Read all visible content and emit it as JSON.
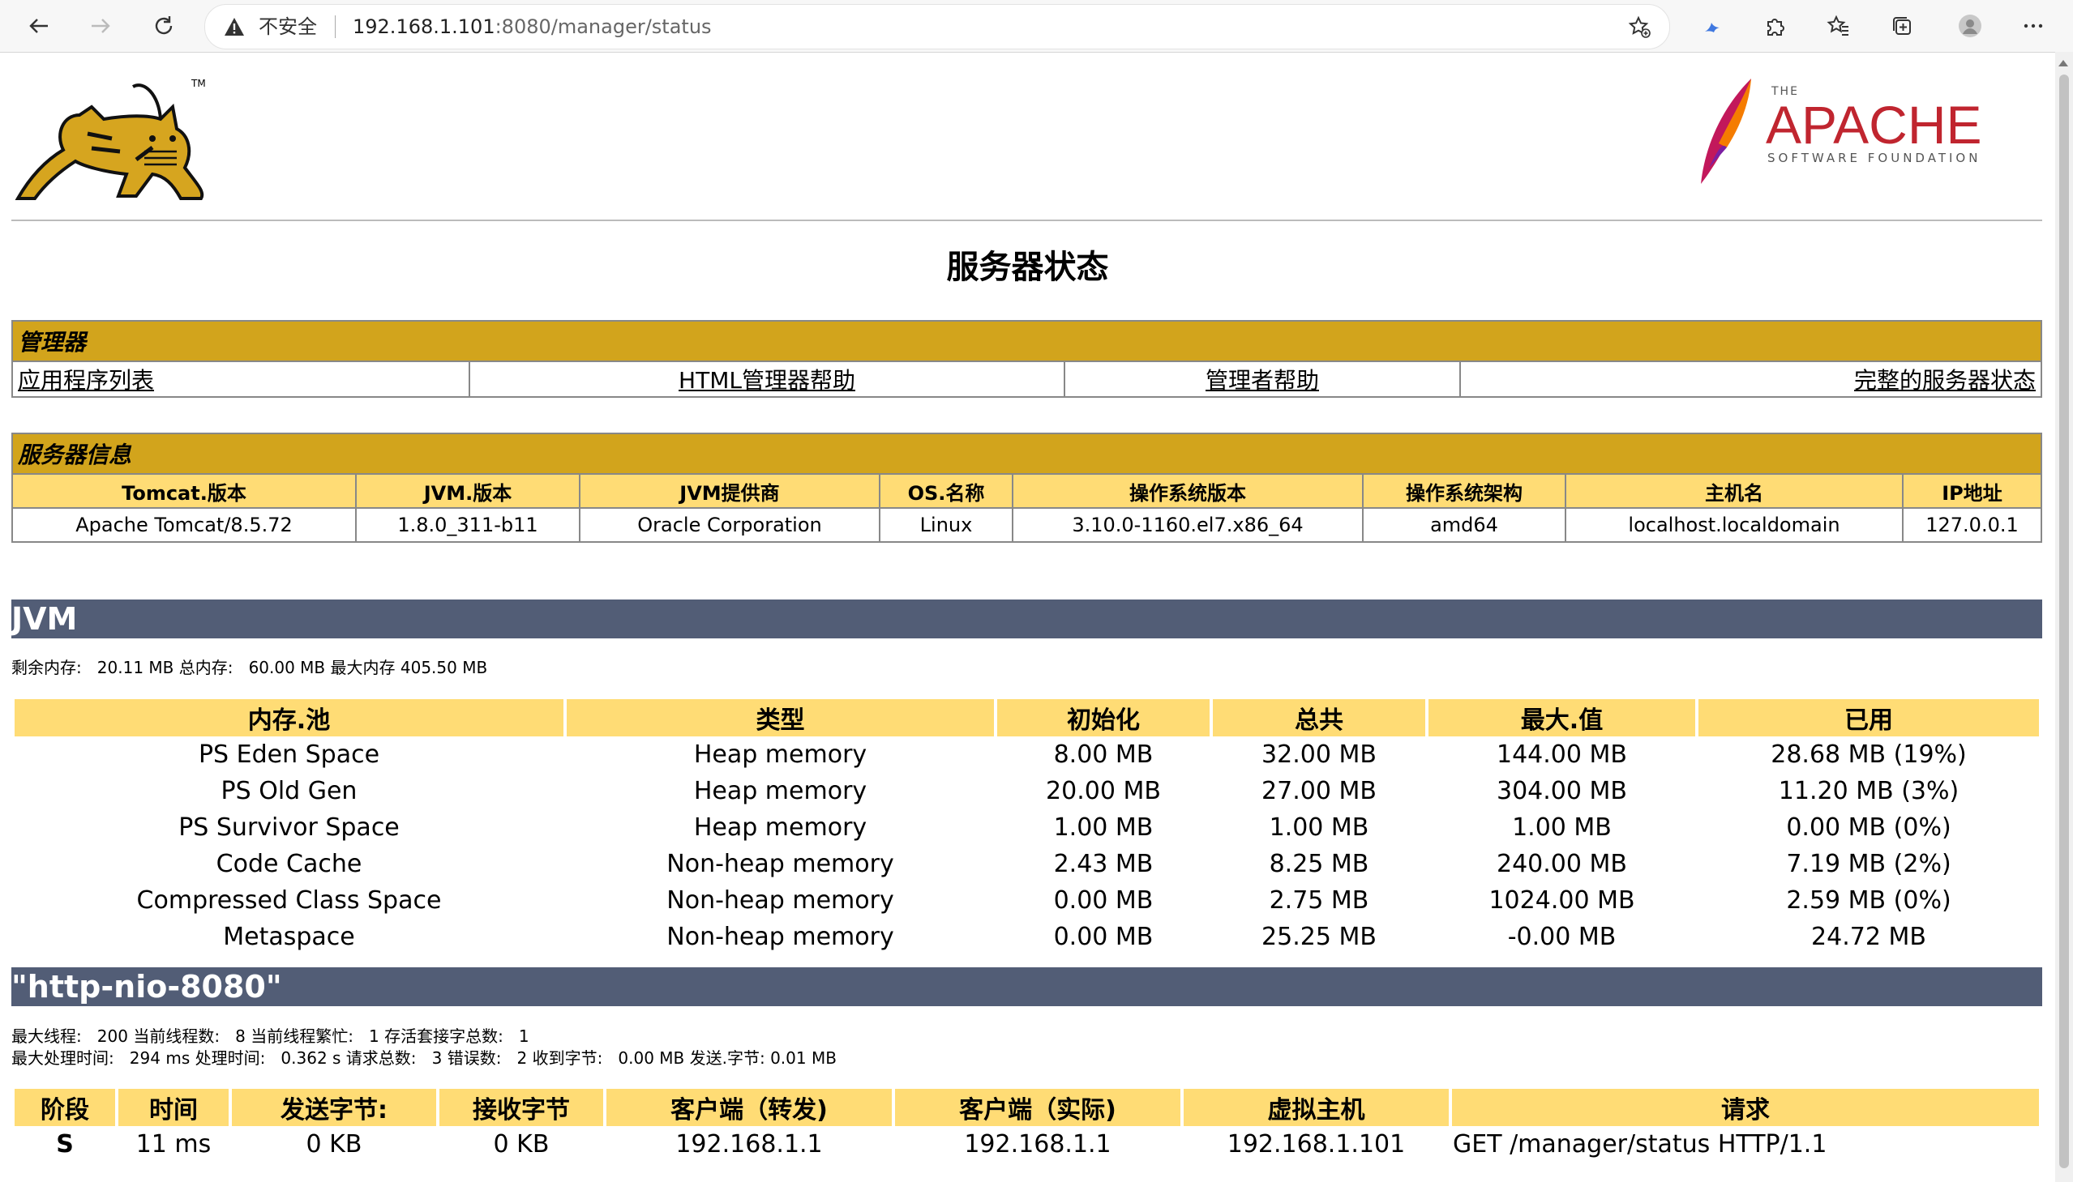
{
  "browser": {
    "insecure_label": "不安全",
    "url_host": "192.168.1.101",
    "url_rest": ":8080/manager/status"
  },
  "page": {
    "title": "服务器状态"
  },
  "manager": {
    "header": "管理器",
    "links": [
      "应用程序列表",
      "HTML管理器帮助",
      "管理者帮助",
      "完整的服务器状态"
    ]
  },
  "server_info": {
    "header": "服务器信息",
    "columns": [
      "Tomcat.版本",
      "JVM.版本",
      "JVM提供商",
      "OS.名称",
      "操作系统版本",
      "操作系统架构",
      "主机名",
      "IP地址"
    ],
    "values": [
      "Apache Tomcat/8.5.72",
      "1.8.0_311-b11",
      "Oracle Corporation",
      "Linux",
      "3.10.0-1160.el7.x86_64",
      "amd64",
      "localhost.localdomain",
      "127.0.0.1"
    ]
  },
  "jvm": {
    "title": "JVM",
    "summary": "剩余内存:   20.11 MB 总内存:   60.00 MB 最大内存 405.50 MB",
    "columns": [
      "内存.池",
      "类型",
      "初始化",
      "总共",
      "最大.值",
      "已用"
    ],
    "rows": [
      [
        "PS Eden Space",
        "Heap memory",
        "8.00 MB",
        "32.00 MB",
        "144.00 MB",
        "28.68 MB (19%)"
      ],
      [
        "PS Old Gen",
        "Heap memory",
        "20.00 MB",
        "27.00 MB",
        "304.00 MB",
        "11.20 MB (3%)"
      ],
      [
        "PS Survivor Space",
        "Heap memory",
        "1.00 MB",
        "1.00 MB",
        "1.00 MB",
        "0.00 MB (0%)"
      ],
      [
        "Code Cache",
        "Non-heap memory",
        "2.43 MB",
        "8.25 MB",
        "240.00 MB",
        "7.19 MB (2%)"
      ],
      [
        "Compressed Class Space",
        "Non-heap memory",
        "0.00 MB",
        "2.75 MB",
        "1024.00 MB",
        "2.59 MB (0%)"
      ],
      [
        "Metaspace",
        "Non-heap memory",
        "0.00 MB",
        "25.25 MB",
        "-0.00 MB",
        "24.72 MB"
      ]
    ]
  },
  "connector": {
    "title": "\"http-nio-8080\"",
    "line1": "最大线程:   200 当前线程数:   8 当前线程繁忙:   1 存活套接字总数:   1",
    "line2": "最大处理时间:   294 ms 处理时间:   0.362 s 请求总数:   3 错误数:   2 收到字节:   0.00 MB 发送.字节: 0.01 MB",
    "columns": [
      "阶段",
      "时间",
      "发送字节:",
      "接收字节",
      "客户端（转发)",
      "客户端（实际)",
      "虚拟主机",
      "请求"
    ],
    "row": [
      "S",
      "11 ms",
      "0 KB",
      "0 KB",
      "192.168.1.1",
      "192.168.1.1",
      "192.168.1.101",
      "GET /manager/status HTTP/1.1"
    ]
  },
  "icons": {
    "back": "arrow-left-icon",
    "forward": "arrow-right-icon",
    "reload": "reload-icon",
    "warning": "warning-icon",
    "favorite_add": "star-add-icon",
    "extension": "puzzle-icon",
    "favorites": "favorites-icon",
    "collections": "collections-icon",
    "profile": "profile-icon",
    "menu": "more-icon"
  },
  "colors": {
    "section_header": "#d2a41c",
    "table_header": "#ffdc75",
    "bar": "#525d76"
  }
}
